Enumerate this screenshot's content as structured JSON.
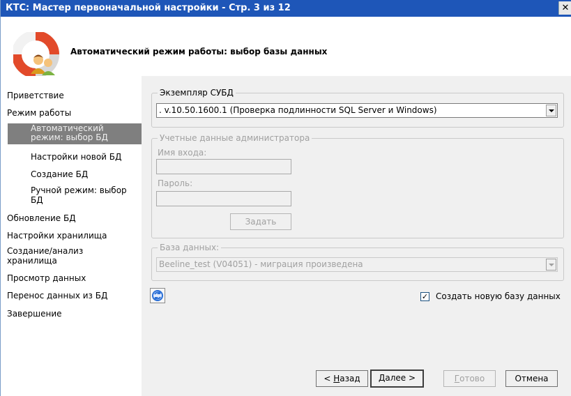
{
  "window": {
    "title": "КТС: Мастер первоначальной настройки - Стр. 3 из 12",
    "close_glyph": "✕"
  },
  "header": {
    "title": "Автоматический режим работы: выбор базы данных",
    "logo_icon": "lifebuoy-users-icon"
  },
  "sidebar": {
    "items": [
      {
        "label": "Приветствие"
      },
      {
        "label": "Режим работы"
      },
      {
        "label": "Автоматический режим: выбор БД",
        "line1": "Автоматический",
        "line2": "режим: выбор БД",
        "active": true
      },
      {
        "label": "Настройки новой БД"
      },
      {
        "label": "Создание БД"
      },
      {
        "label": "Ручной режим: выбор БД",
        "line1": "Ручной режим: выбор",
        "line2": "БД"
      },
      {
        "label": "Обновление БД"
      },
      {
        "label": "Настройки хранилища"
      },
      {
        "label": "Создание/анализ хранилища",
        "line1": "Создание/анализ",
        "line2": "хранилища"
      },
      {
        "label": "Просмотр данных"
      },
      {
        "label": "Перенос данных из БД"
      },
      {
        "label": "Завершение"
      }
    ]
  },
  "dbms": {
    "legend": "Экземпляр СУБД",
    "value": ". v.10.50.1600.1 (Проверка подлинности SQL Server и Windows)"
  },
  "admin": {
    "legend": "Учетные данные администратора",
    "login_label": "Имя входа:",
    "login_value": "",
    "password_label": "Пароль:",
    "password_value": "",
    "set_button": "Задать"
  },
  "database": {
    "legend": "База данных:",
    "value": "Beeline_test (V04051) - миграция произведена"
  },
  "create_new": {
    "label": "Создать новую базу данных",
    "checked": true,
    "check_glyph": "✓"
  },
  "refresh_icon": "refresh-icon",
  "footer": {
    "back_prefix": "< ",
    "back_key": "Н",
    "back_rest": "азад",
    "next_key": "Д",
    "next_rest": "алее >",
    "finish_key": "Г",
    "finish_rest": "отово",
    "cancel": "Отмена"
  },
  "colors": {
    "titlebar": "#1e56b8",
    "active_nav": "#7f7f7f",
    "refresh_icon": "#2a6fd6"
  }
}
